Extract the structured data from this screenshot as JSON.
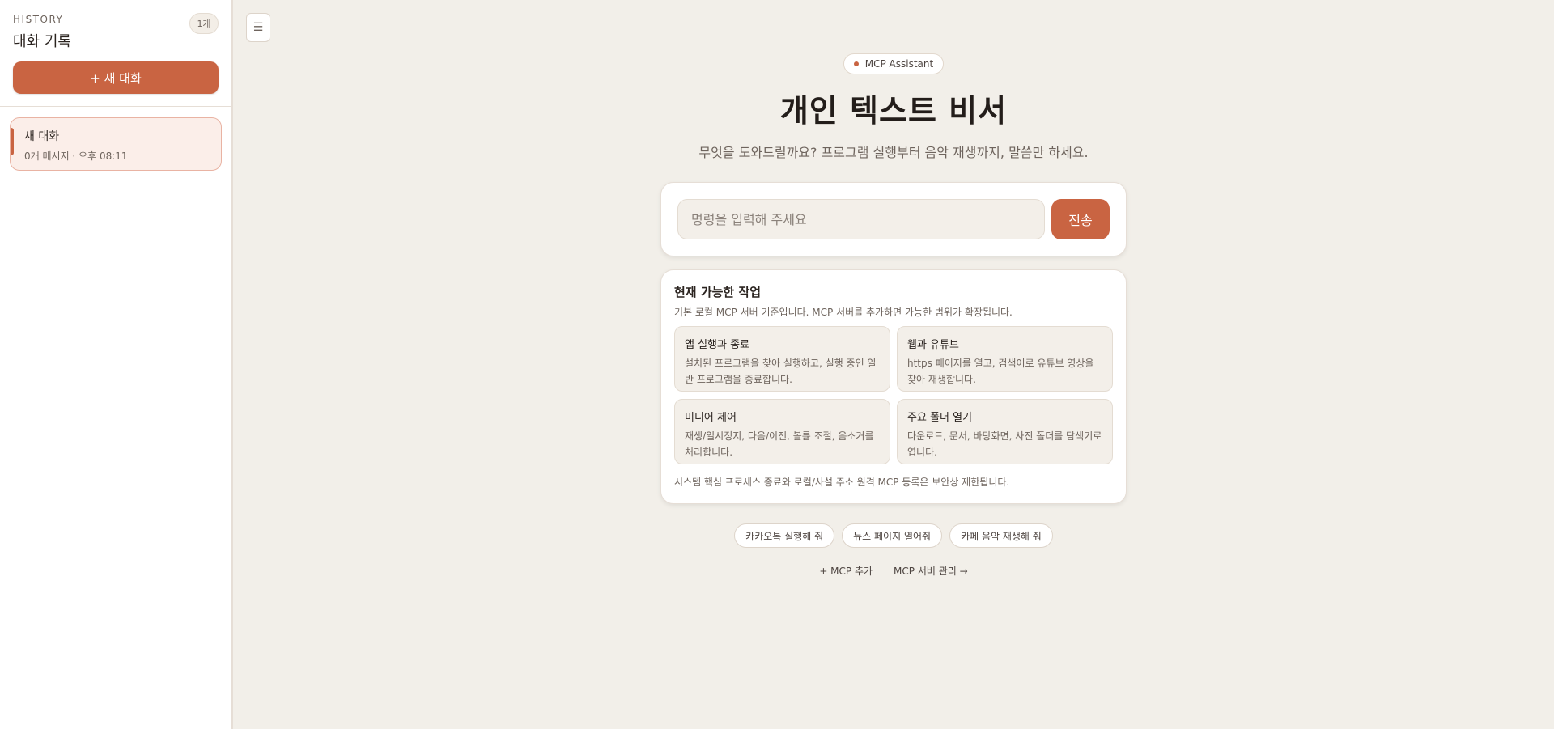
{
  "sidebar": {
    "kicker": "HISTORY",
    "title": "대화 기록",
    "count": "1개",
    "new_chat_label": "+ 새 대화",
    "conversations": [
      {
        "title": "새 대화",
        "meta": "0개 메시지 · 오후 08:11"
      }
    ]
  },
  "header": {
    "menu_icon": "☰"
  },
  "hero": {
    "badge": "MCP Assistant",
    "title": "개인 텍스트 비서",
    "subtitle": "무엇을 도와드릴까요? 프로그램 실행부터 음악 재생까지, 말씀만 하세요."
  },
  "input": {
    "placeholder": "명령을 입력해 주세요",
    "value": "",
    "send_label": "전송"
  },
  "tasks": {
    "title": "현재 가능한 작업",
    "description": "기본 로컬 MCP 서버 기준입니다. MCP 서버를 추가하면 가능한 범위가 확장됩니다.",
    "items": [
      {
        "name": "앱 실행과 종료",
        "text": "설치된 프로그램을 찾아 실행하고, 실행 중인 일반 프로그램을 종료합니다."
      },
      {
        "name": "웹과 유튜브",
        "text": "https 페이지를 열고, 검색어로 유튜브 영상을 찾아 재생합니다."
      },
      {
        "name": "미디어 제어",
        "text": "재생/일시정지, 다음/이전, 볼륨 조절, 음소거를 처리합니다."
      },
      {
        "name": "주요 폴더 열기",
        "text": "다운로드, 문서, 바탕화면, 사진 폴더를 탐색기로 엽니다."
      }
    ],
    "note": "시스템 핵심 프로세스 종료와 로컬/사설 주소 원격 MCP 등록은 보안상 제한됩니다."
  },
  "suggestions": [
    "카카오톡 실행해 줘",
    "뉴스 페이지 열어줘",
    "카페 음악 재생해 줘"
  ],
  "footer_links": {
    "add_mcp": "+ MCP 추가",
    "manage_mcp": "MCP 서버 관리 →"
  },
  "colors": {
    "accent": "#c96442",
    "background": "#f2efe9",
    "card": "#ffffff"
  }
}
